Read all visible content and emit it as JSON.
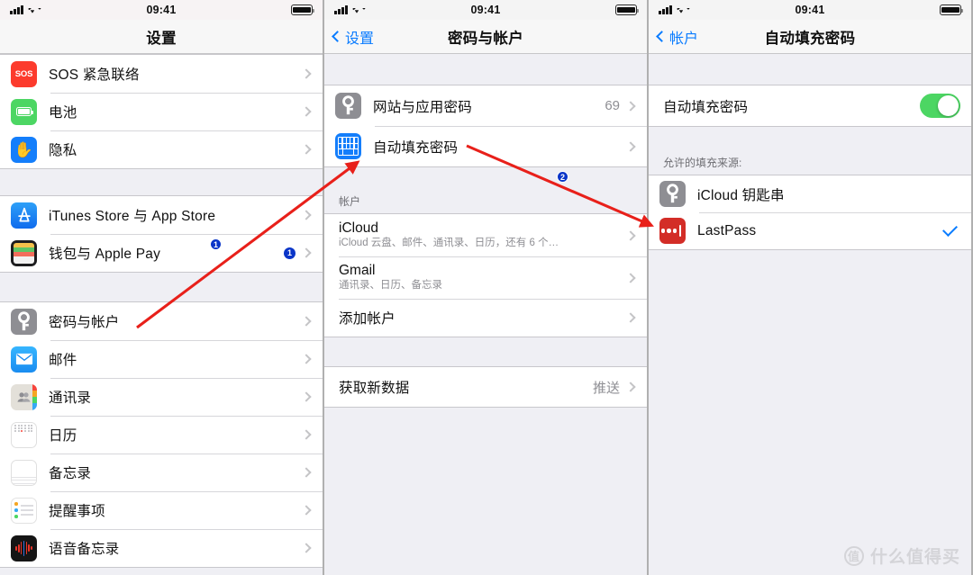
{
  "statusbar": {
    "time": "09:41",
    "signal_icon": "cellular-bars-icon",
    "wifi_icon": "wifi-icon",
    "battery_icon": "battery-full-icon"
  },
  "panel1": {
    "nav_title": "设置",
    "rows_group1": [
      {
        "label": "SOS 紧急联络",
        "icon": "sos-icon",
        "icon_text": "SOS"
      },
      {
        "label": "电池",
        "icon": "battery-icon"
      },
      {
        "label": "隐私",
        "icon": "privacy-hand-icon"
      }
    ],
    "rows_group2": [
      {
        "label": "iTunes Store 与 App Store",
        "icon": "app-store-icon"
      },
      {
        "label": "钱包与 Apple Pay",
        "icon": "wallet-icon",
        "badge": "1"
      }
    ],
    "rows_group3": [
      {
        "label": "密码与帐户",
        "icon": "key-icon"
      },
      {
        "label": "邮件",
        "icon": "mail-icon"
      },
      {
        "label": "通讯录",
        "icon": "contacts-icon"
      },
      {
        "label": "日历",
        "icon": "calendar-icon"
      },
      {
        "label": "备忘录",
        "icon": "notes-icon"
      },
      {
        "label": "提醒事项",
        "icon": "reminders-icon"
      },
      {
        "label": "语音备忘录",
        "icon": "voice-memos-icon"
      }
    ]
  },
  "panel2": {
    "nav_back": "设置",
    "nav_title": "密码与帐户",
    "rows_group1": [
      {
        "label": "网站与应用密码",
        "icon": "key-icon",
        "value": "69"
      },
      {
        "label": "自动填充密码",
        "icon": "keyboard-icon",
        "value": ""
      }
    ],
    "section_accounts_header": "帐户",
    "rows_accounts": [
      {
        "title": "iCloud",
        "subtitle": "iCloud 云盘、邮件、通讯录、日历，还有 6 个…"
      },
      {
        "title": "Gmail",
        "subtitle": "通讯录、日历、备忘录"
      },
      {
        "title": "添加帐户",
        "subtitle": ""
      }
    ],
    "rows_fetch": [
      {
        "label": "获取新数据",
        "value": "推送"
      }
    ]
  },
  "panel3": {
    "nav_back": "帐户",
    "nav_title": "自动填充密码",
    "toggle_row": {
      "label": "自动填充密码",
      "state": "on"
    },
    "section_sources_header": "允许的填充来源:",
    "sources": [
      {
        "label": "iCloud 钥匙串",
        "icon": "key-icon",
        "checked": false
      },
      {
        "label": "LastPass",
        "icon": "lastpass-icon",
        "checked": true
      }
    ]
  },
  "annotations": {
    "markers": [
      {
        "num": "1"
      },
      {
        "num": "2"
      }
    ],
    "arrow_color": "#e8201a"
  },
  "watermark": {
    "logo_char": "值",
    "text": "什么值得买"
  },
  "colors": {
    "accent_blue": "#0a7cff",
    "toggle_green": "#4cd663",
    "badge_blue": "#0a35c8",
    "arrow_red": "#e8201a",
    "group_bg": "#efeff4"
  }
}
